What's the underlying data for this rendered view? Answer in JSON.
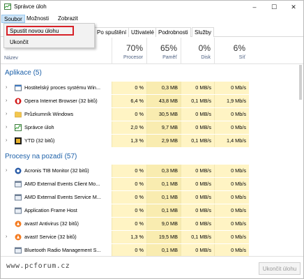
{
  "window": {
    "title": "Správce úloh",
    "controls": {
      "minimize": "–",
      "maximize": "☐",
      "close": "✕"
    }
  },
  "menu": {
    "items": [
      "Soubor",
      "Možnosti",
      "Zobrazit"
    ]
  },
  "dropdown": {
    "items": [
      "Spustit novou úlohu",
      "Ukončit"
    ]
  },
  "tabs": {
    "items": [
      "Po spuštění",
      "Uživatelé",
      "Podrobnosti",
      "Služby"
    ]
  },
  "columns": {
    "name": "Název",
    "cpu": {
      "pct": "70%",
      "label": "Procesor"
    },
    "mem": {
      "pct": "65%",
      "label": "Paměť"
    },
    "disk": {
      "pct": "0%",
      "label": "Disk"
    },
    "net": {
      "pct": "6%",
      "label": "Síť"
    }
  },
  "groups": {
    "apps": "Aplikace (5)",
    "background": "Procesy na pozadí (57)"
  },
  "apps": [
    {
      "name": "Hostitelský proces systému Win...",
      "cpu": "0 %",
      "mem": "0,3 MB",
      "disk": "0 MB/s",
      "net": "0 Mb/s",
      "icon": "windows-host-icon"
    },
    {
      "name": "Opera Internet Browser (32 bitů)",
      "cpu": "6,4 %",
      "mem": "43,8 MB",
      "disk": "0,1 MB/s",
      "net": "1,9 Mb/s",
      "icon": "opera-icon"
    },
    {
      "name": "Průzkumník Windows",
      "cpu": "0 %",
      "mem": "30,5 MB",
      "disk": "0 MB/s",
      "net": "0 Mb/s",
      "icon": "explorer-icon"
    },
    {
      "name": "Správce úloh",
      "cpu": "2,0 %",
      "mem": "9,7 MB",
      "disk": "0 MB/s",
      "net": "0 Mb/s",
      "icon": "task-manager-icon"
    },
    {
      "name": "YTD (32 bitů)",
      "cpu": "1,3 %",
      "mem": "2,9 MB",
      "disk": "0,1 MB/s",
      "net": "1,4 Mb/s",
      "icon": "ytd-icon"
    }
  ],
  "background": [
    {
      "name": "Acronis TIB Monitor (32 bitů)",
      "cpu": "0 %",
      "mem": "0,3 MB",
      "disk": "0 MB/s",
      "net": "0 Mb/s",
      "icon": "acronis-icon"
    },
    {
      "name": "AMD External Events Client Mo...",
      "cpu": "0 %",
      "mem": "0,1 MB",
      "disk": "0 MB/s",
      "net": "0 Mb/s",
      "icon": "service-icon"
    },
    {
      "name": "AMD External Events Service M...",
      "cpu": "0 %",
      "mem": "0,1 MB",
      "disk": "0 MB/s",
      "net": "0 Mb/s",
      "icon": "service-icon"
    },
    {
      "name": "Application Frame Host",
      "cpu": "0 %",
      "mem": "0,1 MB",
      "disk": "0 MB/s",
      "net": "0 Mb/s",
      "icon": "service-icon"
    },
    {
      "name": "avast! Antivirus (32 bitů)",
      "cpu": "0 %",
      "mem": "9,0 MB",
      "disk": "0 MB/s",
      "net": "0 Mb/s",
      "icon": "avast-icon"
    },
    {
      "name": "avast! Service (32 bitů)",
      "cpu": "1,3 %",
      "mem": "19,5 MB",
      "disk": "0,1 MB/s",
      "net": "0 Mb/s",
      "icon": "avast-icon"
    },
    {
      "name": "Bluetooth Radio Management S...",
      "cpu": "0 %",
      "mem": "0,1 MB",
      "disk": "0 MB/s",
      "net": "0 Mb/s",
      "icon": "service-icon"
    }
  ],
  "footer": {
    "watermark": "www.pcforum.cz",
    "end_task": "Ukončit úlohu"
  }
}
